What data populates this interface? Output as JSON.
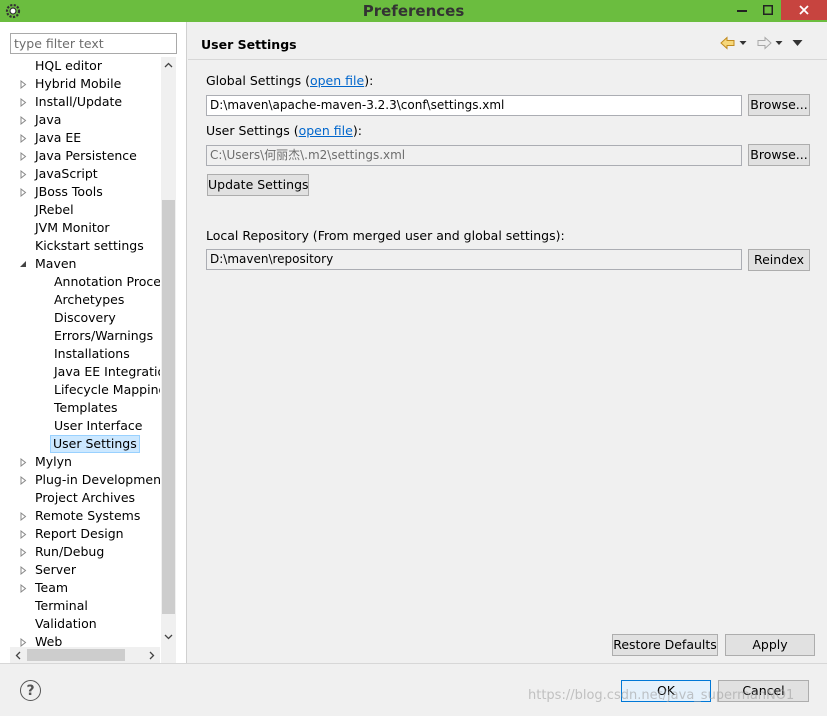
{
  "window": {
    "title": "Preferences"
  },
  "filter": {
    "placeholder": "type filter text"
  },
  "tree": {
    "items": [
      {
        "label": "HQL editor",
        "level": 0,
        "arrow": "none"
      },
      {
        "label": "Hybrid Mobile",
        "level": 0,
        "arrow": "collapsed"
      },
      {
        "label": "Install/Update",
        "level": 0,
        "arrow": "collapsed"
      },
      {
        "label": "Java",
        "level": 0,
        "arrow": "collapsed"
      },
      {
        "label": "Java EE",
        "level": 0,
        "arrow": "collapsed"
      },
      {
        "label": "Java Persistence",
        "level": 0,
        "arrow": "collapsed"
      },
      {
        "label": "JavaScript",
        "level": 0,
        "arrow": "collapsed"
      },
      {
        "label": "JBoss Tools",
        "level": 0,
        "arrow": "collapsed"
      },
      {
        "label": "JRebel",
        "level": 0,
        "arrow": "none"
      },
      {
        "label": "JVM Monitor",
        "level": 0,
        "arrow": "none"
      },
      {
        "label": "Kickstart settings",
        "level": 0,
        "arrow": "none"
      },
      {
        "label": "Maven",
        "level": 0,
        "arrow": "expanded"
      },
      {
        "label": "Annotation Processing",
        "level": 1,
        "arrow": "none"
      },
      {
        "label": "Archetypes",
        "level": 1,
        "arrow": "none"
      },
      {
        "label": "Discovery",
        "level": 1,
        "arrow": "none"
      },
      {
        "label": "Errors/Warnings",
        "level": 1,
        "arrow": "none"
      },
      {
        "label": "Installations",
        "level": 1,
        "arrow": "none"
      },
      {
        "label": "Java EE Integration",
        "level": 1,
        "arrow": "none"
      },
      {
        "label": "Lifecycle Mappings",
        "level": 1,
        "arrow": "none"
      },
      {
        "label": "Templates",
        "level": 1,
        "arrow": "none"
      },
      {
        "label": "User Interface",
        "level": 1,
        "arrow": "none"
      },
      {
        "label": "User Settings",
        "level": 1,
        "arrow": "none",
        "selected": true
      },
      {
        "label": "Mylyn",
        "level": 0,
        "arrow": "collapsed"
      },
      {
        "label": "Plug-in Development",
        "level": 0,
        "arrow": "collapsed"
      },
      {
        "label": "Project Archives",
        "level": 0,
        "arrow": "none"
      },
      {
        "label": "Remote Systems",
        "level": 0,
        "arrow": "collapsed"
      },
      {
        "label": "Report Design",
        "level": 0,
        "arrow": "collapsed"
      },
      {
        "label": "Run/Debug",
        "level": 0,
        "arrow": "collapsed"
      },
      {
        "label": "Server",
        "level": 0,
        "arrow": "collapsed"
      },
      {
        "label": "Team",
        "level": 0,
        "arrow": "collapsed"
      },
      {
        "label": "Terminal",
        "level": 0,
        "arrow": "none"
      },
      {
        "label": "Validation",
        "level": 0,
        "arrow": "none"
      },
      {
        "label": "Web",
        "level": 0,
        "arrow": "collapsed"
      }
    ]
  },
  "page": {
    "title": "User Settings",
    "global_settings_label": "Global Settings (",
    "global_settings_link": "open file",
    "global_settings_suffix": "):",
    "global_settings_value": "D:\\maven\\apache-maven-3.2.3\\conf\\settings.xml",
    "browse_label": "Browse...",
    "user_settings_label": "User Settings (",
    "user_settings_link": "open file",
    "user_settings_suffix": "):",
    "user_settings_value": "C:\\Users\\何丽杰\\.m2\\settings.xml",
    "update_settings_label": "Update Settings",
    "local_repo_label": "Local Repository (From merged user and global settings):",
    "local_repo_value": "D:\\maven\\repository",
    "reindex_label": "Reindex",
    "restore_defaults_label": "Restore Defaults",
    "apply_label": "Apply"
  },
  "footer": {
    "help_symbol": "?",
    "ok_label": "OK",
    "cancel_label": "Cancel",
    "watermark": "https://blog.csdn.net/java_supermanNO1"
  },
  "colors": {
    "titlebar": "#6bbd3f",
    "close_button": "#c7443f",
    "link": "#0066cc",
    "selection": "#cce8ff"
  }
}
